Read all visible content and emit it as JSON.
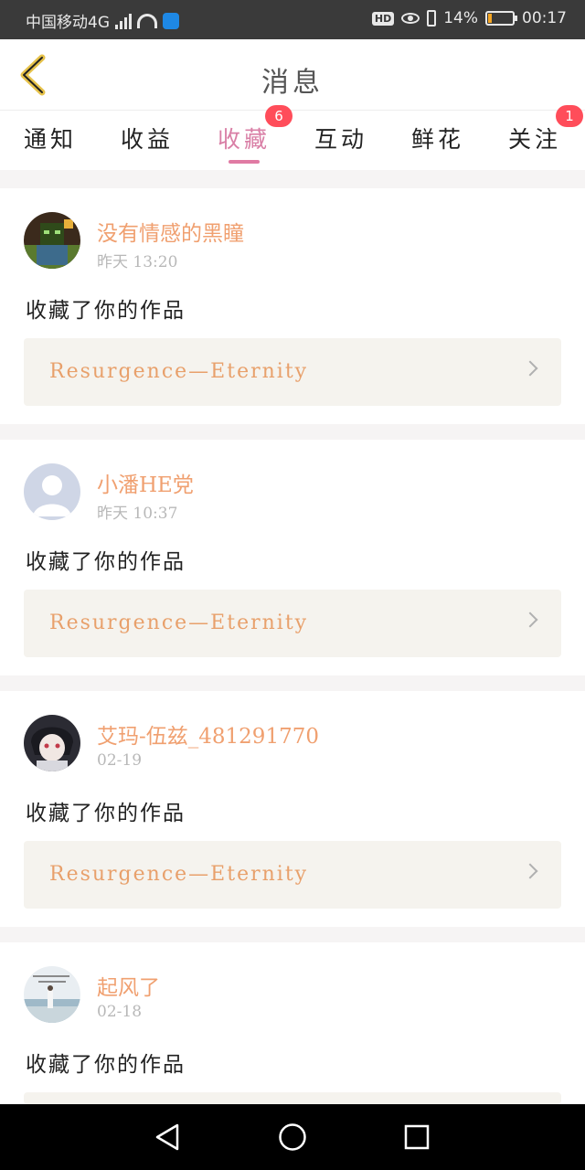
{
  "status_bar": {
    "carrier": "中国移动4G",
    "network_type": "4G",
    "hd_label": "HD",
    "battery_text": "14%",
    "battery_level": 0.14,
    "time": "00:17"
  },
  "header": {
    "title": "消息",
    "back_icon": "back-chevron-icon"
  },
  "tabs": [
    {
      "label": "通知",
      "active": false,
      "badge": ""
    },
    {
      "label": "收益",
      "active": false,
      "badge": ""
    },
    {
      "label": "收藏",
      "active": true,
      "badge": "6"
    },
    {
      "label": "互动",
      "active": false,
      "badge": ""
    },
    {
      "label": "鲜花",
      "active": false,
      "badge": ""
    },
    {
      "label": "关注",
      "active": false,
      "badge": "1"
    }
  ],
  "messages": [
    {
      "user": "没有情感的黑瞳",
      "time": "昨天 13:20",
      "action": "收藏了你的作品",
      "work_title": "Resurgence—Eternity"
    },
    {
      "user": "小潘HE党",
      "time": "昨天 10:37",
      "action": "收藏了你的作品",
      "work_title": "Resurgence—Eternity"
    },
    {
      "user": "艾玛-伍兹_481291770",
      "time": "02-19",
      "action": "收藏了你的作品",
      "work_title": "Resurgence—Eternity"
    },
    {
      "user": "起风了",
      "time": "02-18",
      "action": "收藏了你的作品",
      "work_title": ""
    }
  ],
  "colors": {
    "accent_pink": "#e07aa3",
    "username_orange": "#f0a070",
    "badge_red": "#ff4d5a",
    "work_box_bg": "#f5f3ee"
  },
  "nav_bar": {
    "back_icon": "triangle-back-icon",
    "home_icon": "circle-home-icon",
    "recents_icon": "square-recents-icon"
  }
}
